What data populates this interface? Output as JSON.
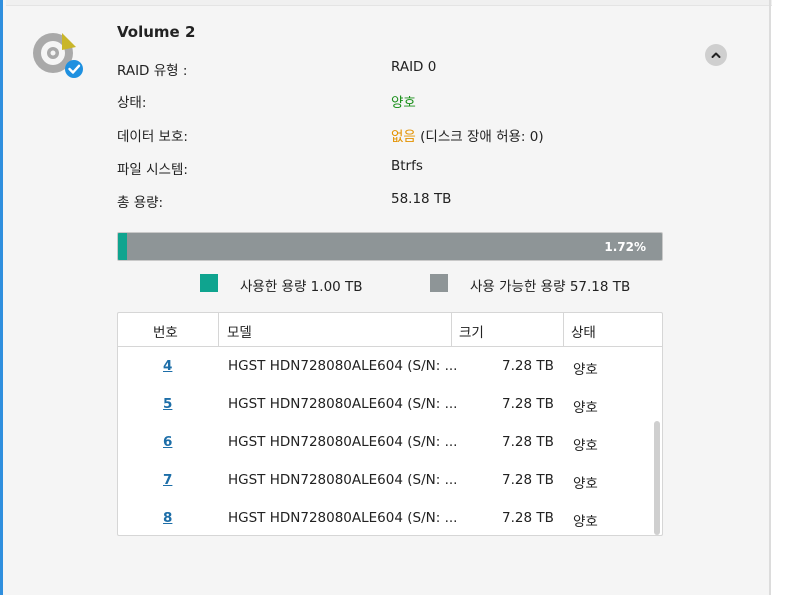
{
  "volume": {
    "title": "Volume 2",
    "details": [
      {
        "label": "RAID 유형 :",
        "value": "RAID 0",
        "value_color": "default"
      },
      {
        "label": "상태:",
        "value": "양호",
        "value_color": "green"
      },
      {
        "label": "데이터 보호:",
        "value": "없음",
        "value_suffix": " (디스크 장애 허용: 0)",
        "value_color": "orange"
      },
      {
        "label": "파일 시스템:",
        "value": "Btrfs",
        "value_color": "default"
      },
      {
        "label": "총 용량:",
        "value": "58.18 TB",
        "value_color": "default"
      }
    ]
  },
  "usage": {
    "percent_label": "1.72%",
    "used_fraction": 0.0172,
    "used_label": "사용한 용량 1.00 TB",
    "available_label": "사용 가능한 용량 57.18 TB",
    "used_color": "#0fa48f",
    "available_color": "#8e9597"
  },
  "disk_table": {
    "headers": [
      "번호",
      "모델",
      "크기",
      "상태"
    ],
    "rows": [
      {
        "number": "4",
        "model": "HGST HDN728080ALE604 (S/N: ...",
        "size": "7.28 TB",
        "status": "양호"
      },
      {
        "number": "5",
        "model": "HGST HDN728080ALE604 (S/N: ...",
        "size": "7.28 TB",
        "status": "양호"
      },
      {
        "number": "6",
        "model": "HGST HDN728080ALE604 (S/N: ...",
        "size": "7.28 TB",
        "status": "양호"
      },
      {
        "number": "7",
        "model": "HGST HDN728080ALE604 (S/N: ...",
        "size": "7.28 TB",
        "status": "양호"
      },
      {
        "number": "8",
        "model": "HGST HDN728080ALE604 (S/N: ...",
        "size": "7.28 TB",
        "status": "양호"
      }
    ]
  },
  "icons": {
    "volume": "volume-disk-icon",
    "status_check": "check-badge-icon",
    "collapse": "chevron-up-icon"
  },
  "colors": {
    "accent": "#2f8fde",
    "status_ok": "#1a8f1a",
    "warning": "#e39200",
    "link": "#1d6ea8"
  }
}
